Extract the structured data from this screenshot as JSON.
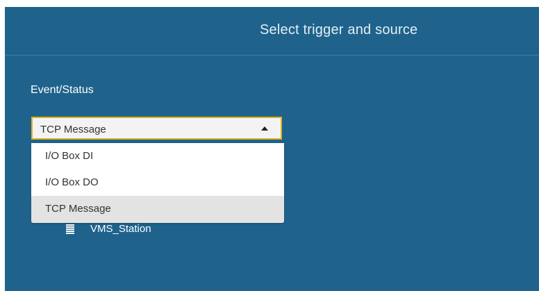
{
  "dialog": {
    "title": "Select trigger and source"
  },
  "event_status": {
    "label": "Event/Status",
    "selected_value": "TCP Message",
    "options": [
      {
        "label": "I/O Box DI"
      },
      {
        "label": "I/O Box DO"
      },
      {
        "label": "TCP Message",
        "selected": true
      }
    ]
  },
  "source_tree": {
    "items": [
      {
        "label": "VMS_Station",
        "icon": "server-icon"
      }
    ]
  },
  "colors": {
    "panel_background": "#1f638c",
    "select_border_focus": "#e0b21e",
    "option_highlight": "#e3e3e3"
  }
}
